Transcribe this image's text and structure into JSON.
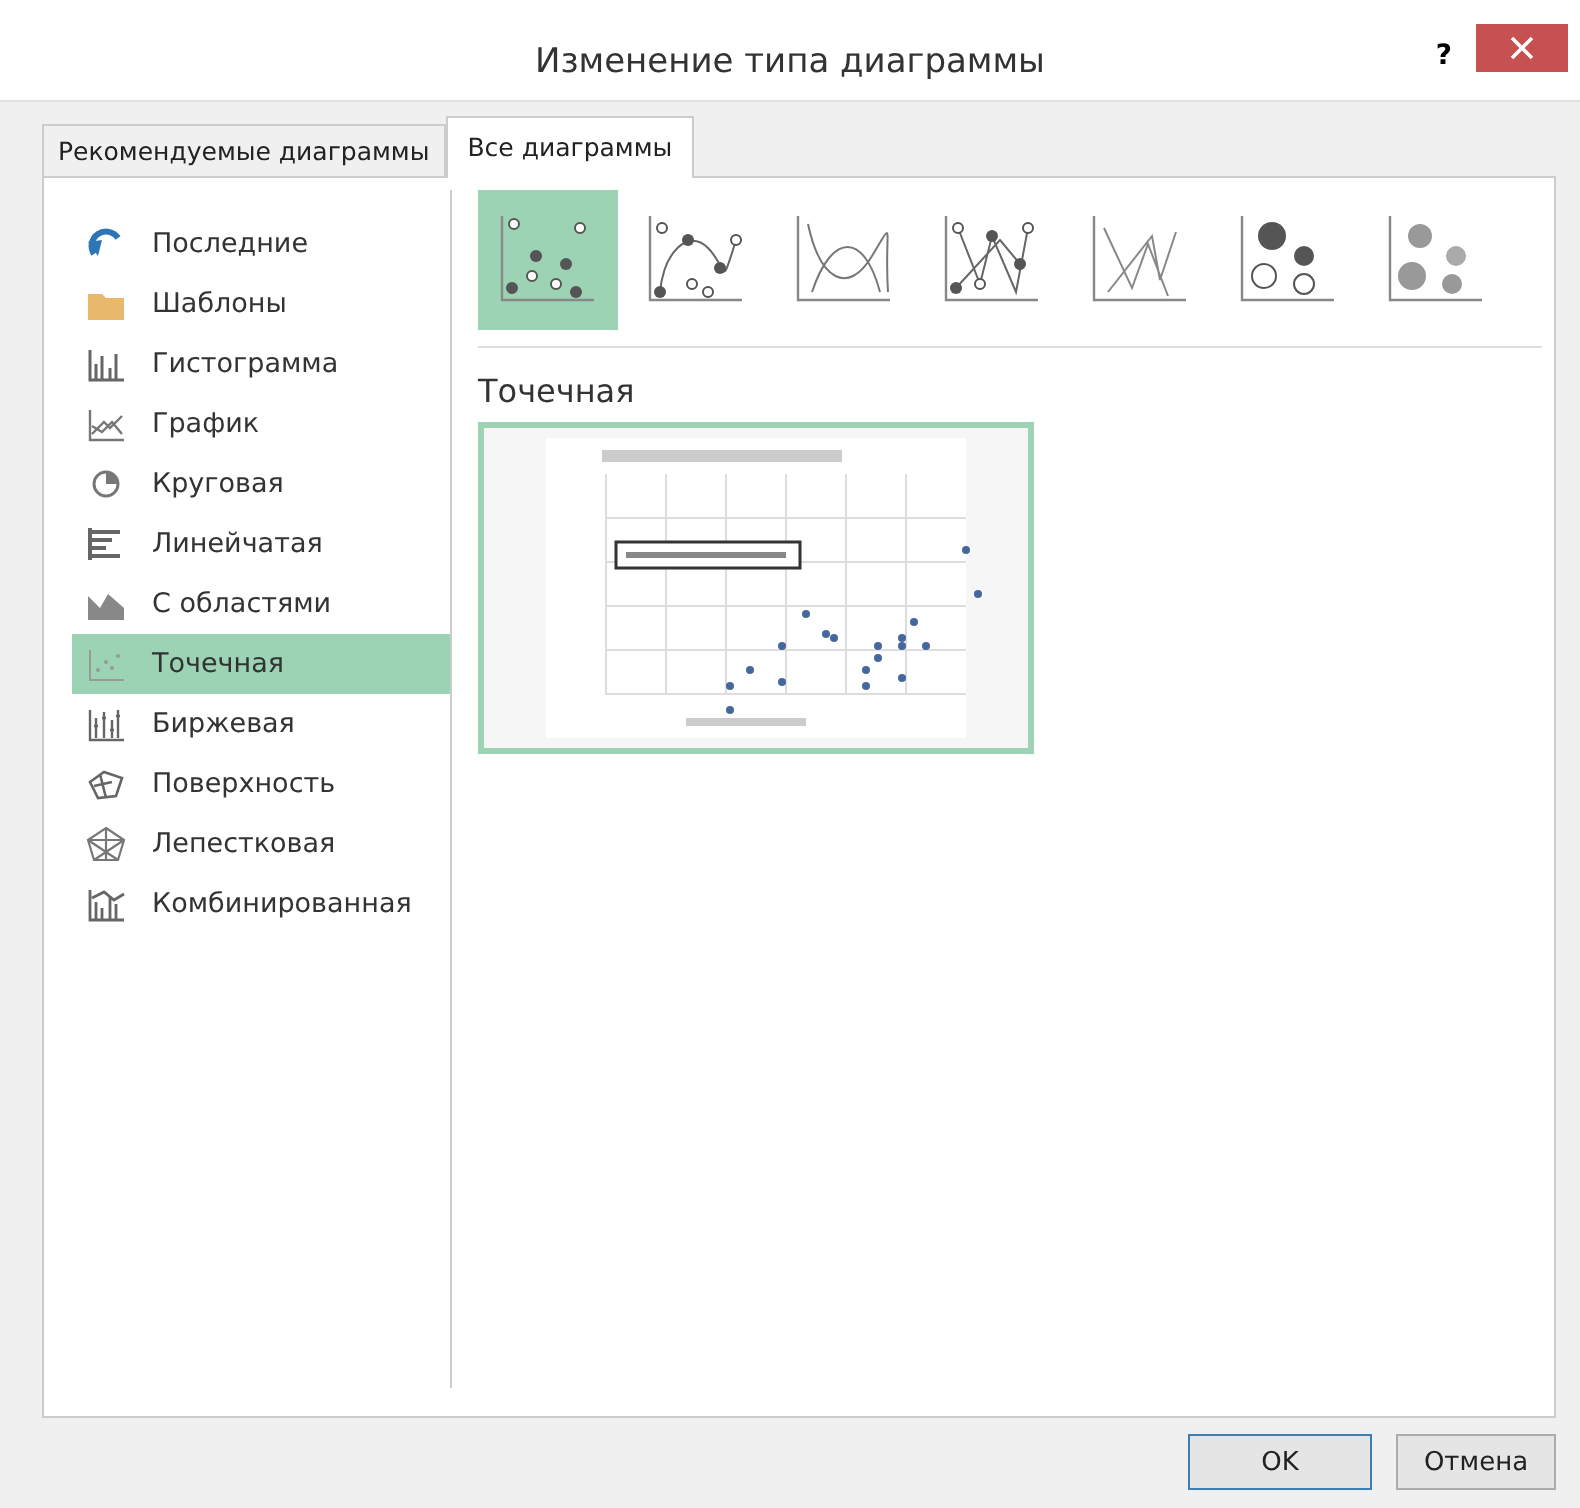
{
  "window": {
    "title": "Изменение типа диаграммы",
    "help": "?"
  },
  "tabs": [
    {
      "label": "Рекомендуемые диаграммы",
      "selected": false
    },
    {
      "label": "Все диаграммы",
      "selected": true
    }
  ],
  "sidebar": {
    "items": [
      {
        "label": "Последние",
        "kind": "recent",
        "selected": false
      },
      {
        "label": "Шаблоны",
        "kind": "folder",
        "selected": false
      },
      {
        "label": "Гистограмма",
        "kind": "column",
        "selected": false
      },
      {
        "label": "График",
        "kind": "line",
        "selected": false
      },
      {
        "label": "Круговая",
        "kind": "pie",
        "selected": false
      },
      {
        "label": "Линейчатая",
        "kind": "bar",
        "selected": false
      },
      {
        "label": "С областями",
        "kind": "area",
        "selected": false
      },
      {
        "label": "Точечная",
        "kind": "scatter",
        "selected": true
      },
      {
        "label": "Биржевая",
        "kind": "stock",
        "selected": false
      },
      {
        "label": "Поверхность",
        "kind": "surface",
        "selected": false
      },
      {
        "label": "Лепестковая",
        "kind": "radar",
        "selected": false
      },
      {
        "label": "Комбинированная",
        "kind": "combo",
        "selected": false
      }
    ]
  },
  "subtypes": [
    {
      "kind": "markers",
      "selected": true
    },
    {
      "kind": "smooth-markers",
      "selected": false
    },
    {
      "kind": "smooth",
      "selected": false
    },
    {
      "kind": "straight-markers",
      "selected": false
    },
    {
      "kind": "straight",
      "selected": false
    },
    {
      "kind": "bubble",
      "selected": false
    },
    {
      "kind": "bubble-3d",
      "selected": false
    }
  ],
  "section_title": "Точечная",
  "buttons": [
    {
      "label": "OK",
      "kind": "default"
    },
    {
      "label": "Отмена",
      "kind": "normal"
    }
  ]
}
